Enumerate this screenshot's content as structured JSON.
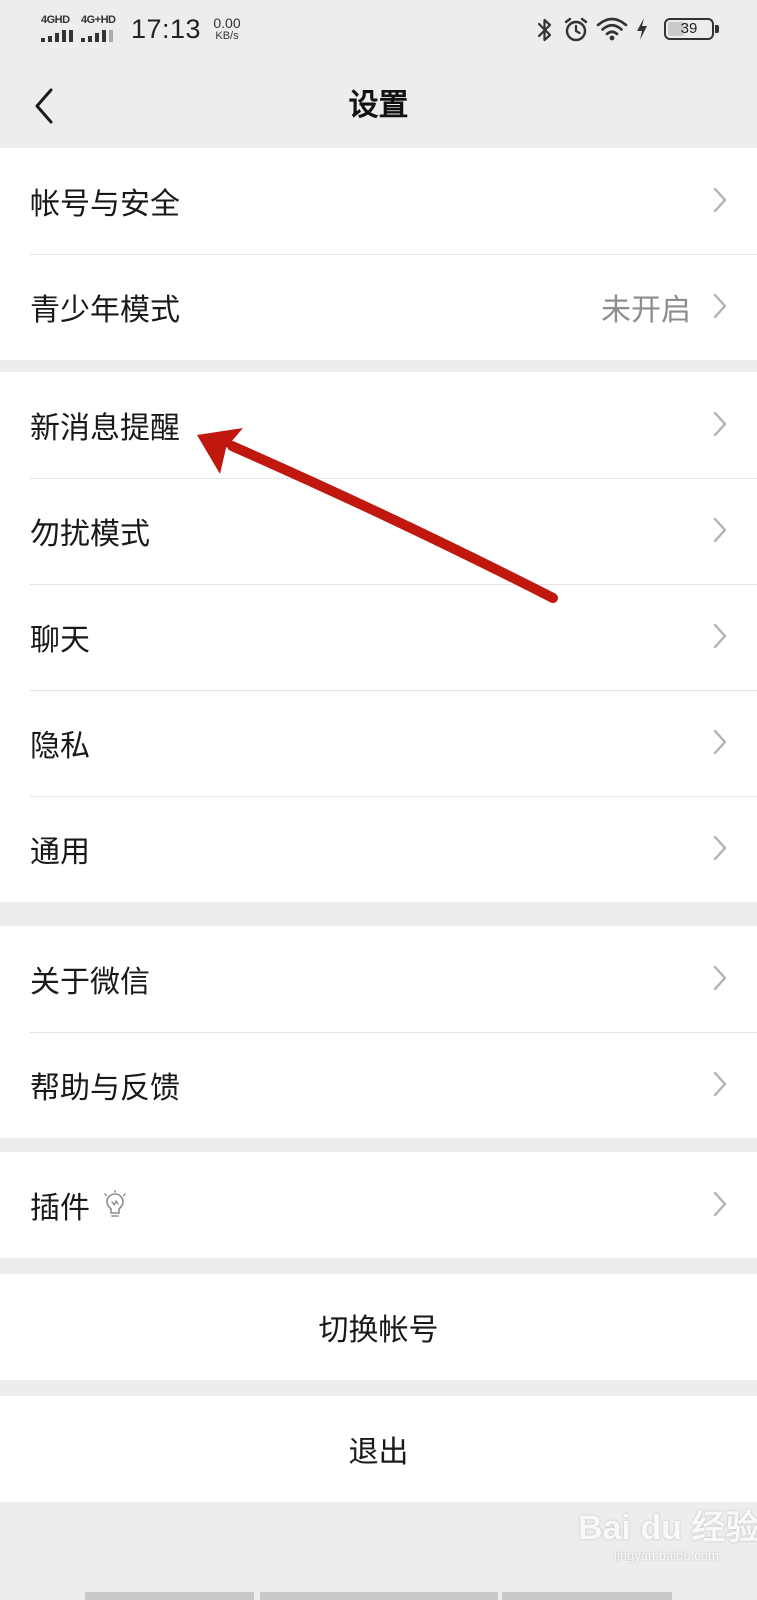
{
  "status_bar": {
    "network1": "4GHD",
    "network2": "4G+HD",
    "time": "17:13",
    "speed_value": "0.00",
    "speed_unit": "KB/s",
    "battery_pct": "39",
    "battery_level": 0.39,
    "icons": [
      "bluetooth-icon",
      "alarm-icon",
      "wifi-icon",
      "charging-icon",
      "battery-icon"
    ]
  },
  "nav": {
    "title": "设置",
    "back_icon": "chevron-left-icon"
  },
  "group1": {
    "items": [
      {
        "label": "帐号与安全",
        "value": ""
      },
      {
        "label": "青少年模式",
        "value": "未开启"
      }
    ]
  },
  "group2": {
    "items": [
      {
        "label": "新消息提醒"
      },
      {
        "label": "勿扰模式"
      },
      {
        "label": "聊天"
      },
      {
        "label": "隐私"
      },
      {
        "label": "通用"
      }
    ]
  },
  "group3": {
    "items": [
      {
        "label": "关于微信"
      },
      {
        "label": "帮助与反馈"
      }
    ]
  },
  "group4": {
    "items": [
      {
        "label": "插件",
        "icon": "lightbulb-icon"
      }
    ]
  },
  "actions": {
    "switch_account": "切换帐号",
    "logout": "退出"
  },
  "annotation": {
    "arrow_color": "#c0170f"
  },
  "watermark": {
    "logo": "Bai du 经验",
    "sub": "jingyan.baidu.com"
  },
  "colors": {
    "background": "#ededed",
    "cell": "#ffffff",
    "text": "#191919",
    "secondary": "#8d8d8d",
    "chevron": "#b2b2b2"
  }
}
